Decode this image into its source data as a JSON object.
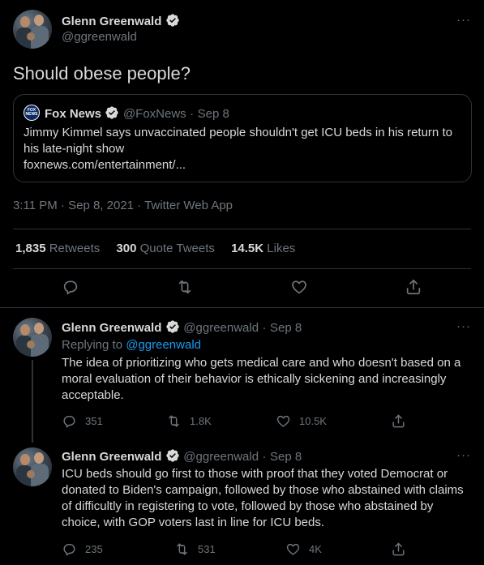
{
  "main_tweet": {
    "name": "Glenn Greenwald",
    "handle": "@ggreenwald",
    "text": "Should obese people?",
    "quote": {
      "source_logo_text": "FOX NEWS",
      "name": "Fox News",
      "handle": "@FoxNews",
      "date": "Sep 8",
      "text": "Jimmy Kimmel says unvaccinated people shouldn't get ICU beds in his return to his late-night show",
      "link": "foxnews.com/entertainment/..."
    },
    "time": "3:11 PM",
    "date": "Sep 8, 2021",
    "client": "Twitter Web App",
    "stats": {
      "retweets_count": "1,835",
      "retweets_label": "Retweets",
      "quotes_count": "300",
      "quotes_label": "Quote Tweets",
      "likes_count": "14.5K",
      "likes_label": "Likes"
    }
  },
  "replies": [
    {
      "name": "Glenn Greenwald",
      "handle": "@ggreenwald",
      "date": "Sep 8",
      "replying_to_prefix": "Replying to",
      "replying_to": "@ggreenwald",
      "text": "The idea of prioritizing who gets medical care and who doesn't based on a moral evaluation of their behavior is ethically sickening and increasingly acceptable.",
      "replies": "351",
      "retweets": "1.8K",
      "likes": "10.5K"
    },
    {
      "name": "Glenn Greenwald",
      "handle": "@ggreenwald",
      "date": "Sep 8",
      "text": "ICU beds should go first to those with proof that they voted Democrat or donated to Biden's campaign, followed by those who abstained with claims of difficultly in registering to vote, followed by those who abstained by choice, with GOP voters last in line for ICU beds.",
      "replies": "235",
      "retweets": "531",
      "likes": "4K"
    }
  ],
  "separators": {
    "dot": "·",
    "more": "···"
  },
  "colors": {
    "background": "#000000",
    "text": "#d9d9d9",
    "muted": "#6e767d",
    "link": "#1d9bf0",
    "verified": "#d9d9d9",
    "border": "#2f3336"
  }
}
